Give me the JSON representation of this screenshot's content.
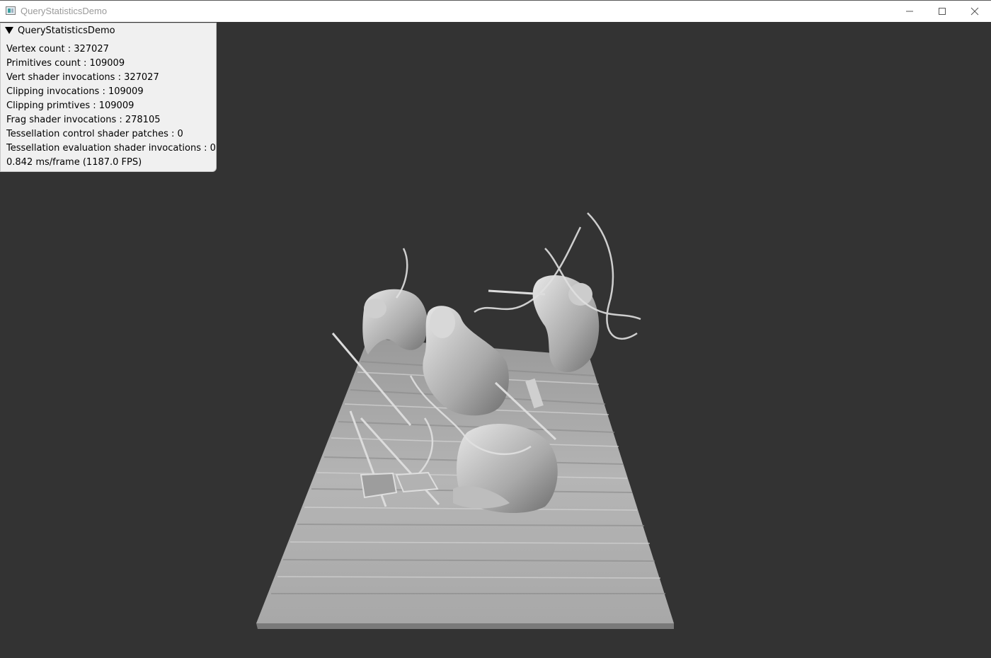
{
  "window": {
    "title": "QueryStatisticsDemo",
    "icon": "app-window-icon",
    "controls": {
      "minimize": "minimize-icon",
      "maximize": "maximize-icon",
      "close": "close-icon"
    }
  },
  "overlay": {
    "title": "QueryStatisticsDemo",
    "stats": [
      "Vertex count : 327027",
      "Primitives count : 109009",
      "Vert shader invocations : 327027",
      "Clipping invocations : 109009",
      "Clipping primtives : 109009",
      "Frag shader invocations : 278105",
      "Tessellation control shader patches : 0",
      "Tessellation evaluation shader invocations : 0",
      "0.842 ms/frame (1187.0 FPS)"
    ]
  },
  "colors": {
    "background": "#333333",
    "panel": "#f0f0f0",
    "titlebar": "#ffffff",
    "title_text": "#9a9a9a"
  }
}
